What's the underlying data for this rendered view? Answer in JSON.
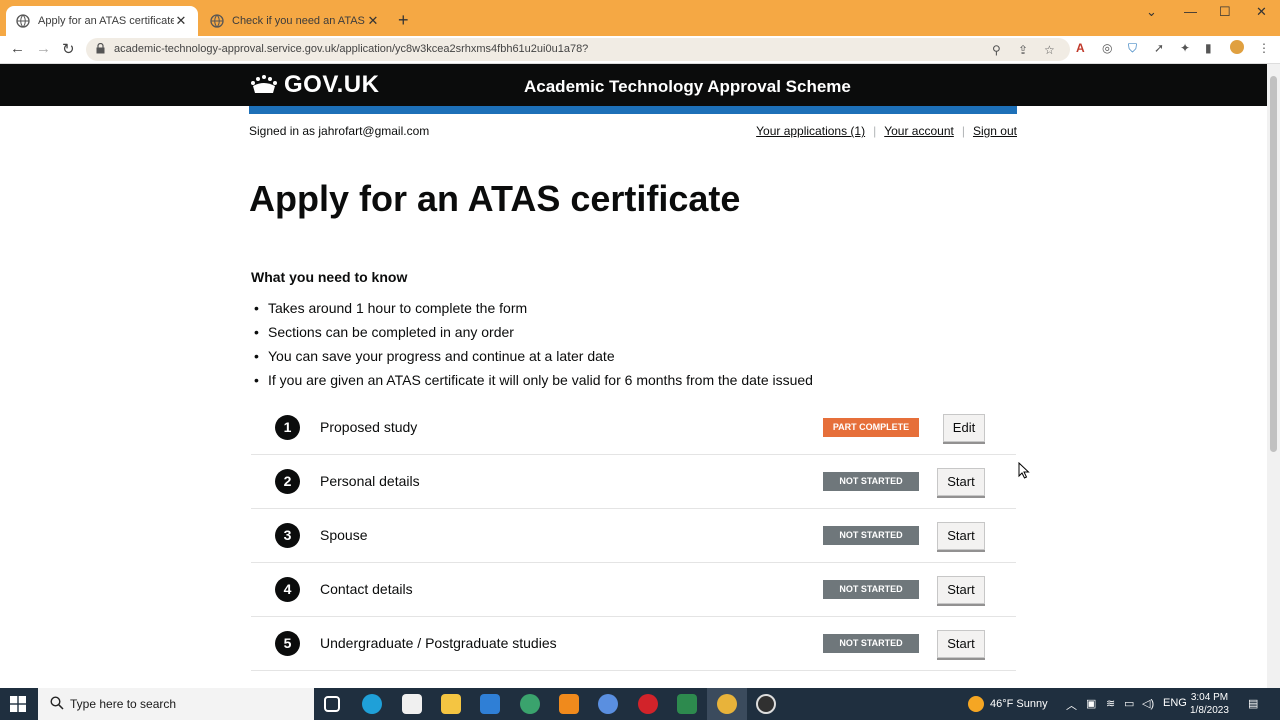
{
  "browser": {
    "tabs": [
      {
        "title": "Apply for an ATAS certificate",
        "active": true
      },
      {
        "title": "Check if you need an ATAS certificate",
        "active": false
      }
    ],
    "url": "academic-technology-approval.service.gov.uk/application/yc8w3kcea2srhxms4fbh61u2ui0u1a78?"
  },
  "header": {
    "logo_text": "GOV.UK",
    "service_name": "Academic Technology Approval Scheme"
  },
  "account": {
    "signed_in": "Signed in as jahrofart@gmail.com",
    "links": [
      "Your applications (1)",
      "Your account",
      "Sign out"
    ]
  },
  "main": {
    "title": "Apply for an ATAS certificate",
    "know_heading": "What you need to know",
    "know_items": [
      "Takes around 1 hour to complete the form",
      "Sections can be completed in any order",
      "You can save your progress and continue at a later date",
      "If you are given an ATAS certificate it will only be valid for 6 months from the date issued"
    ],
    "tasks": [
      {
        "number": "1",
        "name": "Proposed study",
        "status": "PART COMPLETE",
        "action": "Edit"
      },
      {
        "number": "2",
        "name": "Personal details",
        "status": "NOT STARTED",
        "action": "Start"
      },
      {
        "number": "3",
        "name": "Spouse",
        "status": "NOT STARTED",
        "action": "Start"
      },
      {
        "number": "4",
        "name": "Contact details",
        "status": "NOT STARTED",
        "action": "Start"
      },
      {
        "number": "5",
        "name": "Undergraduate / Postgraduate studies",
        "status": "NOT STARTED",
        "action": "Start"
      }
    ]
  },
  "taskbar": {
    "search_placeholder": "Type here to search",
    "weather": "46°F  Sunny",
    "language": "ENG",
    "time": "3:04 PM",
    "date": "1/8/2023"
  },
  "colors": {
    "tab_strip": "#f5a844",
    "gov_black": "#0b0c0c",
    "gov_blue": "#1d70b8",
    "part_complete": "#e66f3a",
    "not_started": "#6f777b"
  }
}
